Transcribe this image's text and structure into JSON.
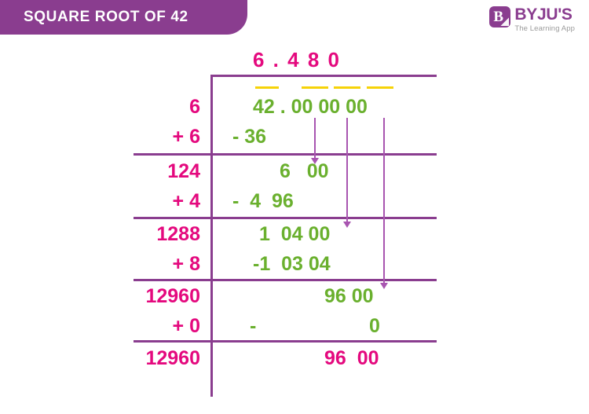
{
  "header": {
    "title": "SQUARE ROOT OF 42",
    "banner_color": "#8a3d8f"
  },
  "logo": {
    "mark_letter": "B",
    "wordmark": "BYJU'S",
    "tagline": "The Learning App"
  },
  "colors": {
    "purple": "#8a3d8f",
    "pink": "#e4097e",
    "green": "#6ab02e",
    "yellow": "#f6d308",
    "arrow": "#a855b0"
  },
  "worksheet": {
    "quotient": "6 . 4 8 0",
    "divisors": [
      {
        "top": "6",
        "add": "+ 6"
      },
      {
        "top": "124",
        "add": "+ 4"
      },
      {
        "top": "1288",
        "add": "+ 8"
      },
      {
        "top": "12960",
        "add": "+ 0"
      },
      {
        "top": "12960",
        "add": ""
      }
    ],
    "dividend_rows": [
      {
        "value": "42 . 00 00 00",
        "subtract": "- 36"
      },
      {
        "value": "6   00",
        "subtract": "-  4  96"
      },
      {
        "value": "1  04 00",
        "subtract": "-1  03 04"
      },
      {
        "value": "96 00",
        "subtract_sign": "-",
        "subtract_value": "0"
      },
      {
        "value": "96  00"
      }
    ]
  }
}
